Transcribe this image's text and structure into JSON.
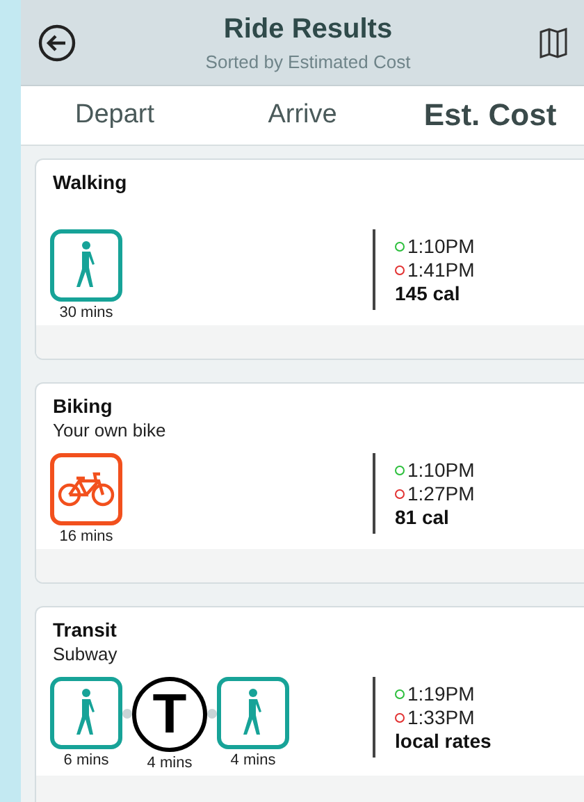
{
  "header": {
    "title": "Ride Results",
    "subtitle": "Sorted by Estimated Cost"
  },
  "tabs": [
    {
      "label": "Depart",
      "selected": false
    },
    {
      "label": "Arrive",
      "selected": false
    },
    {
      "label": "Est. Cost",
      "selected": true
    }
  ],
  "results": [
    {
      "title": "Walking",
      "segments": [
        {
          "kind": "walk",
          "duration": "30 mins"
        }
      ],
      "depart": "1:10PM",
      "arrive": "1:41PM",
      "cost": "145 cal"
    },
    {
      "title": "Biking",
      "subtitle": "Your own bike",
      "segments": [
        {
          "kind": "bike",
          "duration": "16 mins"
        }
      ],
      "depart": "1:10PM",
      "arrive": "1:27PM",
      "cost": "81 cal"
    },
    {
      "title": "Transit",
      "subtitle": "Subway",
      "segments": [
        {
          "kind": "walk",
          "duration": "6 mins"
        },
        {
          "kind": "subway",
          "logo": "T",
          "duration": "4 mins"
        },
        {
          "kind": "walk",
          "duration": "4 mins"
        }
      ],
      "depart": "1:19PM",
      "arrive": "1:33PM",
      "cost": "local rates"
    }
  ]
}
